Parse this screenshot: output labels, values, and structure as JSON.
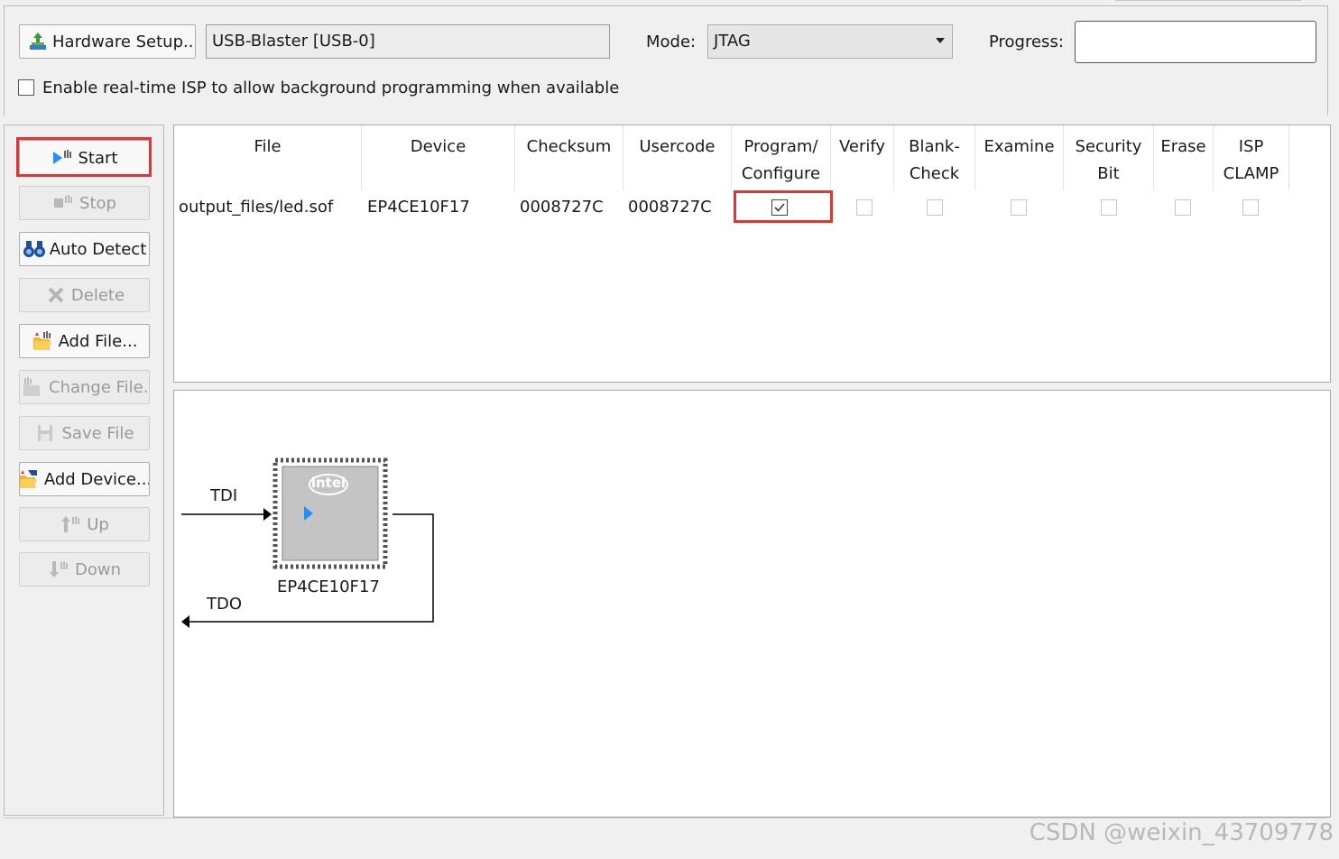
{
  "toolbar": {
    "hardware_setup_label": "Hardware Setup...",
    "hardware_value": "USB-Blaster [USB-0]",
    "mode_label": "Mode:",
    "mode_value": "JTAG",
    "progress_label": "Progress:",
    "isp_checkbox_label": "Enable real-time ISP to allow background programming when available",
    "isp_checked": false
  },
  "sidebar": {
    "buttons": [
      {
        "label": "Start",
        "icon": "start-icon",
        "enabled": true,
        "highlighted": true
      },
      {
        "label": "Stop",
        "icon": "stop-icon",
        "enabled": false
      },
      {
        "label": "Auto Detect",
        "icon": "binoculars-icon",
        "enabled": true
      },
      {
        "label": "Delete",
        "icon": "delete-icon",
        "enabled": false
      },
      {
        "label": "Add File...",
        "icon": "add-file-icon",
        "enabled": true
      },
      {
        "label": "Change File...",
        "icon": "change-file-icon",
        "enabled": false
      },
      {
        "label": "Save File",
        "icon": "save-file-icon",
        "enabled": false
      },
      {
        "label": "Add Device...",
        "icon": "add-device-icon",
        "enabled": true
      },
      {
        "label": "Up",
        "icon": "up-icon",
        "enabled": false
      },
      {
        "label": "Down",
        "icon": "down-icon",
        "enabled": false
      }
    ]
  },
  "table": {
    "headers": {
      "file": "File",
      "device": "Device",
      "checksum": "Checksum",
      "usercode": "Usercode",
      "program_1": "Program/",
      "program_2": "Configure",
      "verify": "Verify",
      "blank_1": "Blank-",
      "blank_2": "Check",
      "examine": "Examine",
      "security_1": "Security",
      "security_2": "Bit",
      "erase": "Erase",
      "isp_1": "ISP",
      "isp_2": "CLAMP"
    },
    "rows": [
      {
        "file": "output_files/led.sof",
        "device": "EP4CE10F17",
        "checksum": "0008727C",
        "usercode": "0008727C",
        "program_configure": true,
        "verify": false,
        "blank_check": false,
        "examine": false,
        "security_bit": false,
        "erase": false,
        "isp_clamp": false
      }
    ]
  },
  "chain": {
    "tdi_label": "TDI",
    "tdo_label": "TDO",
    "chip_logo": "intel",
    "device_label": "EP4CE10F17"
  },
  "watermark": "CSDN @weixin_43709778",
  "colors": {
    "highlight": "#e03535",
    "chip_body": "#c4c4c4",
    "chip_pins": "#555555",
    "play_arrow": "#1e90ff"
  }
}
